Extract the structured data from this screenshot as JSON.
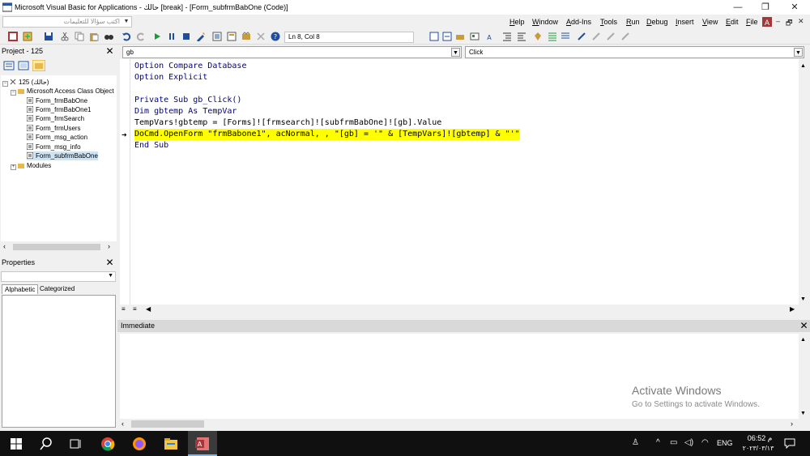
{
  "window": {
    "title": "Microsoft Visual Basic for Applications - حالك [break] - [Form_subfrmBabOne (Code)]",
    "controls": {
      "minimize": "—",
      "restore": "❐",
      "close": "✕"
    }
  },
  "menubar": {
    "language_combo": "اكتب سؤالا للتعليمات",
    "items": [
      {
        "label": "Help",
        "u": "H",
        "rest": "elp"
      },
      {
        "label": "Window",
        "u": "W",
        "rest": "indow"
      },
      {
        "label": "Add-Ins",
        "u": "A",
        "rest": "dd-Ins"
      },
      {
        "label": "Tools",
        "u": "T",
        "rest": "ools"
      },
      {
        "label": "Run",
        "u": "R",
        "rest": "un"
      },
      {
        "label": "Debug",
        "u": "D",
        "rest": "ebug"
      },
      {
        "label": "Insert",
        "u": "I",
        "rest": "nsert"
      },
      {
        "label": "View",
        "u": "V",
        "rest": "iew"
      },
      {
        "label": "Edit",
        "u": "E",
        "rest": "dit"
      },
      {
        "label": "File",
        "u": "F",
        "rest": "ile"
      }
    ],
    "mdi": {
      "minimize": "–",
      "restore": "🗗",
      "close": "✕"
    }
  },
  "toolbar": {
    "cursor_position": "Ln 8, Col 8"
  },
  "project": {
    "title": "Project - 125",
    "root": "125 (حالك)",
    "folder": "Microsoft Access Class Object",
    "items": [
      "Form_frmBabOne",
      "Form_frmBabOne1",
      "Form_frmSearch",
      "Form_frmUsers",
      "Form_msg_action",
      "Form_msg_info",
      "Form_subfrmBabOne"
    ],
    "modules": "Modules"
  },
  "properties": {
    "title": "Properties",
    "tabs": [
      "Alphabetic",
      "Categorized"
    ]
  },
  "code": {
    "object": "gb",
    "procedure": "Click",
    "lines": [
      {
        "text": "Option Compare Database",
        "type": "kw"
      },
      {
        "text": "Option Explicit",
        "type": "kw"
      },
      {
        "text": "",
        "type": "plain"
      },
      {
        "text": "Private Sub gb_Click()",
        "type": "kw"
      },
      {
        "text": "Dim gbtemp As TempVar",
        "type": "kw"
      },
      {
        "text": "TempVars!gbtemp = [Forms]![frmsearch]![subfrmBabOne]![gb].Value",
        "type": "plain"
      },
      {
        "text": "DoCmd.OpenForm \"frmBabone1\", acNormal, , \"[gb] = '\" & [TempVars]![gbtemp] & \"'\"",
        "type": "hl"
      },
      {
        "text": "End Sub",
        "type": "kw"
      }
    ]
  },
  "immediate": {
    "title": "Immediate"
  },
  "watermark": {
    "line1": "Activate Windows",
    "line2": "Go to Settings to activate Windows."
  },
  "taskbar": {
    "language": "ENG",
    "time": "06:52 م",
    "date": "٢٠٢٣/٠٣/١٣"
  },
  "colors": {
    "keyword": "#00008b",
    "highlight": "#ffff00",
    "taskbar": "#101010"
  }
}
